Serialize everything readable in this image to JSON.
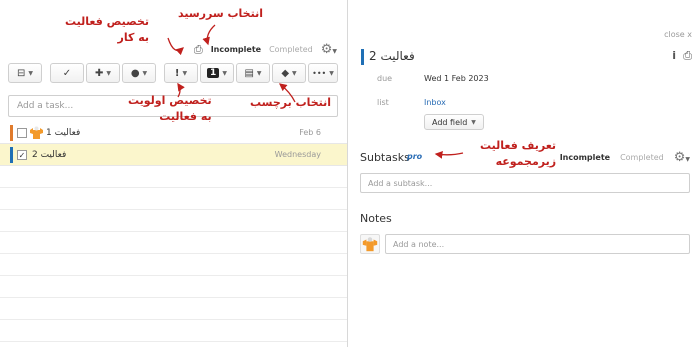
{
  "list_tabs": {
    "print_icon": "printer-icon",
    "incomplete": "Incomplete",
    "completed": "Completed",
    "settings_icon": "gear-icon"
  },
  "toolbar": {
    "buttons": [
      {
        "icon": "minus-square-icon",
        "glyph": "⊟"
      },
      {
        "icon": "checkmark-icon",
        "glyph": "✓"
      },
      {
        "icon": "add-user-icon",
        "glyph": "✚"
      },
      {
        "icon": "person-icon",
        "glyph": "●"
      },
      {
        "icon": "priority-icon",
        "glyph": "!"
      },
      {
        "icon": "star-count-icon",
        "glyph": "1"
      },
      {
        "icon": "list-icon",
        "glyph": "▤"
      },
      {
        "icon": "tag-icon",
        "glyph": "◆"
      },
      {
        "icon": "more-icon",
        "glyph": "•••"
      }
    ]
  },
  "add_task": {
    "placeholder": "Add a task..."
  },
  "tasks": [
    {
      "title": "فعالیت 1",
      "date": "Feb 6",
      "checked": false,
      "priority_color": "#e07b2c",
      "has_avatar": true,
      "selected": false
    },
    {
      "title": "فعالیت 2",
      "date": "Wednesday",
      "checked": true,
      "priority_color": "#1f6fb5",
      "has_avatar": false,
      "selected": true
    }
  ],
  "detail": {
    "close": "close x",
    "title": "فعالیت 2",
    "info_icon": "info-icon",
    "print_icon": "printer-icon",
    "due_label": "due",
    "due_value": "Wed 1 Feb 2023",
    "list_label": "list",
    "list_value": "Inbox",
    "add_field": "Add field",
    "subtasks_title": "Subtasks",
    "pro": "pro",
    "sub_incomplete": "Incomplete",
    "sub_completed": "Completed",
    "sub_placeholder": "Add a subtask...",
    "notes_title": "Notes",
    "note_placeholder": "Add a note..."
  },
  "annotations": {
    "due_date": "انتخاب سررسید",
    "assign": "تخصیص فعالیت\nبه کار",
    "priority": "تخصیص اولویت\nبه فعالیت",
    "tag": "انتخاب برچسب",
    "subtask": "تعریف فعالیت\nزیرمجموعه"
  },
  "colors": {
    "annotation": "#c0201d",
    "selected_row": "#fbf6cc",
    "link": "#2a6db5"
  }
}
